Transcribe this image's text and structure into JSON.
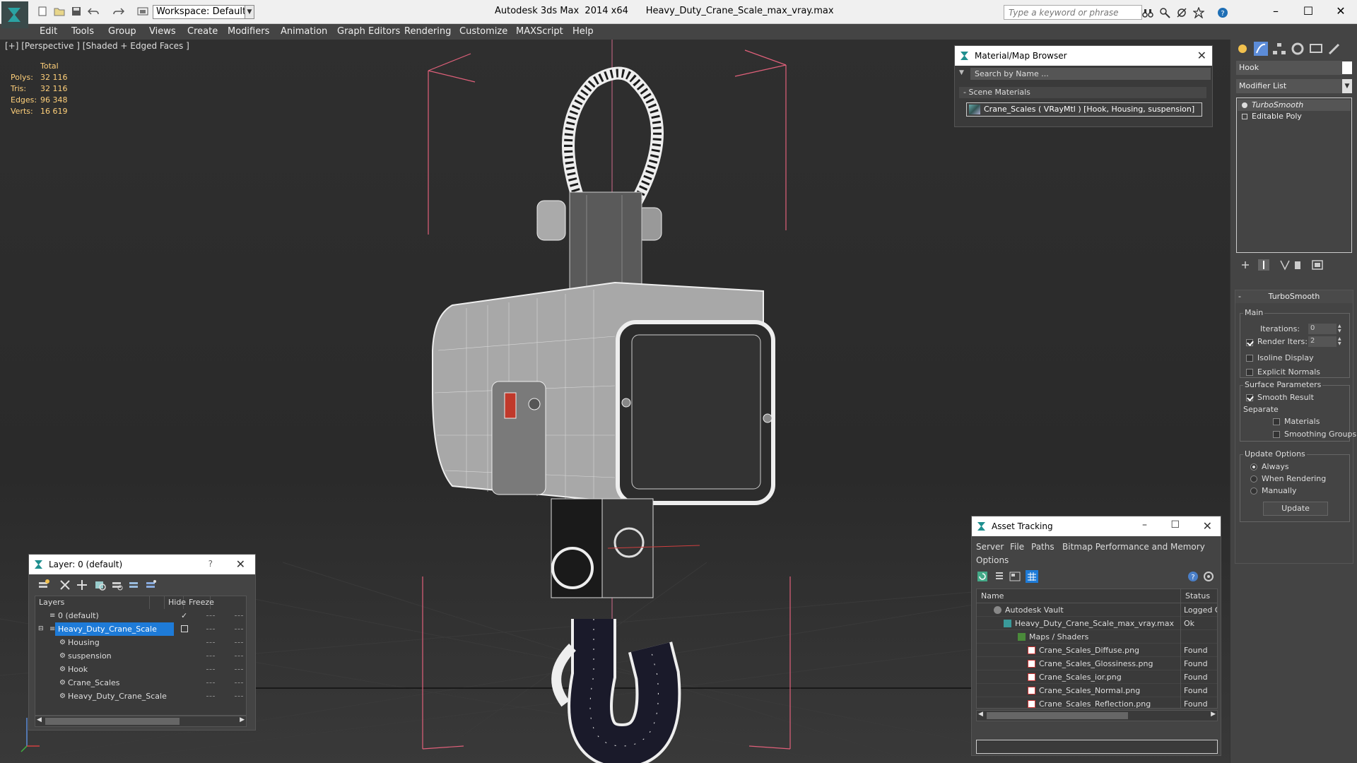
{
  "titlebar": {
    "workspace": "Workspace: Default",
    "app_name": "Autodesk 3ds Max  2014 x64",
    "file_name": "Heavy_Duty_Crane_Scale_max_vray.max",
    "search_placeholder": "Type a keyword or phrase",
    "icons": [
      "new-file-icon",
      "open-file-icon",
      "save-icon",
      "undo-icon",
      "redo-icon",
      "project-folder-icon",
      "binoculars-icon",
      "search-tools-icon",
      "favorites-icon",
      "help-icon"
    ]
  },
  "menu": [
    "Edit",
    "Tools",
    "Group",
    "Views",
    "Create",
    "Modifiers",
    "Animation",
    "Graph Editors",
    "Rendering",
    "Customize",
    "MAXScript",
    "Help"
  ],
  "viewport": {
    "label": "[+] [Perspective ] [Shaded + Edged Faces ]",
    "stats": {
      "header": "Total",
      "rows": [
        {
          "label": "Polys:",
          "value": "32 116"
        },
        {
          "label": "Tris:",
          "value": "32 116"
        },
        {
          "label": "Edges:",
          "value": "96 348"
        },
        {
          "label": "Verts:",
          "value": "16 619"
        }
      ]
    }
  },
  "material_browser": {
    "title": "Material/Map Browser",
    "search_placeholder": "Search by Name ...",
    "section": "- Scene Materials",
    "material": "Crane_Scales  ( VRayMtl ) [Hook, Housing, suspension]"
  },
  "command_panel": {
    "object_name": "Hook",
    "modifier_list": "Modifier List",
    "stack": [
      "TurboSmooth",
      "Editable Poly"
    ],
    "rollout_title": "TurboSmooth",
    "main_group": "Main",
    "iterations_label": "Iterations:",
    "iterations_value": "0",
    "render_iters_label": "Render Iters:",
    "render_iters_value": "2",
    "render_iters_checked": true,
    "isoline_label": "Isoline Display",
    "explicit_normals_label": "Explicit Normals",
    "surface_group": "Surface Parameters",
    "smooth_result_label": "Smooth Result",
    "separate_label": "Separate",
    "materials_label": "Materials",
    "smoothing_groups_label": "Smoothing Groups",
    "update_group": "Update Options",
    "always_label": "Always",
    "when_rendering_label": "When Rendering",
    "manually_label": "Manually",
    "update_button": "Update"
  },
  "layer_dialog": {
    "title": "Layer: 0 (default)",
    "help": "?",
    "col_layers": "Layers",
    "col_hide": "Hide",
    "col_freeze": "Freeze",
    "rows": [
      {
        "name": "0 (default)",
        "indent": 0
      },
      {
        "name": "Heavy_Duty_Crane_Scale",
        "indent": 0
      },
      {
        "name": "Housing",
        "indent": 1
      },
      {
        "name": "suspension",
        "indent": 1
      },
      {
        "name": "Hook",
        "indent": 1
      },
      {
        "name": "Crane_Scales",
        "indent": 1
      },
      {
        "name": "Heavy_Duty_Crane_Scale",
        "indent": 1
      }
    ]
  },
  "asset_tracking": {
    "title": "Asset Tracking",
    "menu": [
      "Server",
      "File",
      "Paths",
      "Bitmap Performance and Memory",
      "Options"
    ],
    "col_name": "Name",
    "col_status": "Status",
    "rows": [
      {
        "name": "Autodesk Vault",
        "status": "Logged Out"
      },
      {
        "name": "Heavy_Duty_Crane_Scale_max_vray.max",
        "status": "Ok"
      },
      {
        "name": "Maps / Shaders",
        "status": ""
      },
      {
        "name": "Crane_Scales_Diffuse.png",
        "status": "Found"
      },
      {
        "name": "Crane_Scales_Glossiness.png",
        "status": "Found"
      },
      {
        "name": "Crane_Scales_ior.png",
        "status": "Found"
      },
      {
        "name": "Crane_Scales_Normal.png",
        "status": "Found"
      },
      {
        "name": "Crane_Scales_Reflection.png",
        "status": "Found"
      }
    ]
  },
  "colors": {
    "selection": "#1e7bd8",
    "stats_text": "#ffd07a",
    "bounding_box": "#e0607a"
  }
}
